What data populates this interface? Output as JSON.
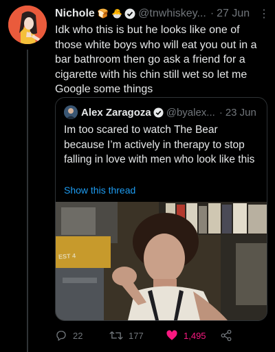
{
  "tweet": {
    "author_name": "Nichole",
    "emojis": [
      "🍞",
      "🐣"
    ],
    "handle": "@tnwhiskey...",
    "separator": "·",
    "date": "27 Jun",
    "more": "⋮",
    "text": "Idk who this is but he looks like one of those white boys who will eat you out in a bar bathroom then go ask a friend for a cigarette with his chin still wet so let me Google some things"
  },
  "quoted": {
    "author_name": "Alex Zaragoza",
    "handle": "@byalex...",
    "separator": "·",
    "date": "23 Jun",
    "text": "Im too scared to watch The Bear because I’m actively in therapy to stop falling in love with men who look like this",
    "show_thread": "Show this thread",
    "image_sign_text": "EST 4"
  },
  "actions": {
    "replies": "22",
    "retweets": "177",
    "likes": "1,495"
  },
  "colors": {
    "background": "#000000",
    "text": "#e7e9ea",
    "muted": "#71767b",
    "link": "#1d9bf0",
    "like": "#f91880",
    "verified": "#1d9bf0"
  }
}
